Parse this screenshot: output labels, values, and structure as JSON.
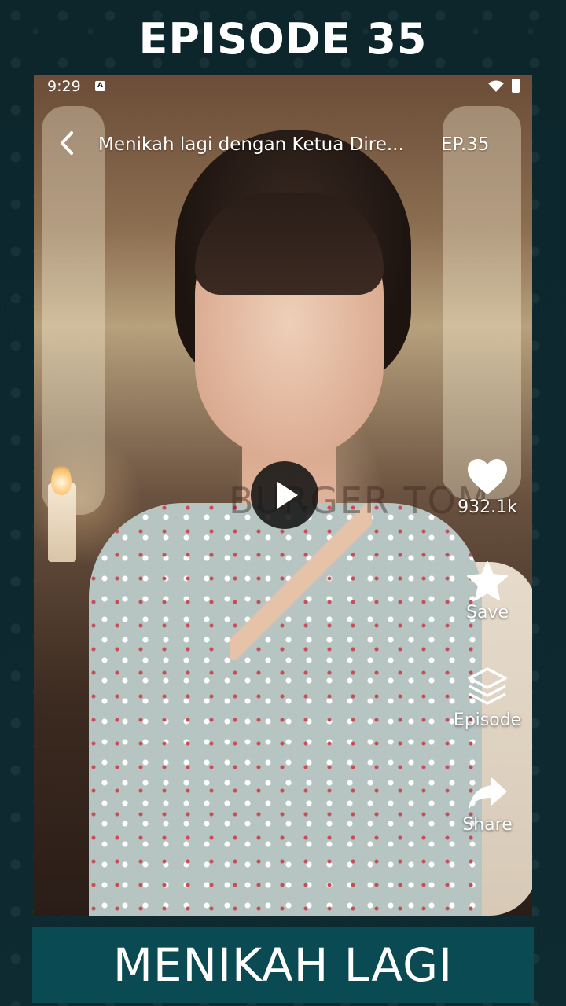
{
  "header": {
    "episode_title": "EPISODE 35"
  },
  "status_bar": {
    "time": "9:29",
    "app_icon_letter": "A"
  },
  "player": {
    "title": "Menikah lagi dengan Ketua Dire...",
    "episode": "EP.35",
    "watermark": "BURGER TOM"
  },
  "actions": {
    "likes": "932.1k",
    "save_label": "Save",
    "episode_label": "Episode",
    "share_label": "Share"
  },
  "footer": {
    "caption": "MENIKAH LAGI"
  },
  "colors": {
    "background": "#0f2a30",
    "footer_banner": "#0a4a52",
    "text": "#ffffff"
  },
  "icons": [
    "back-chevron-icon",
    "play-icon",
    "heart-icon",
    "star-icon",
    "layers-icon",
    "share-arrow-icon",
    "wifi-icon",
    "battery-icon"
  ]
}
